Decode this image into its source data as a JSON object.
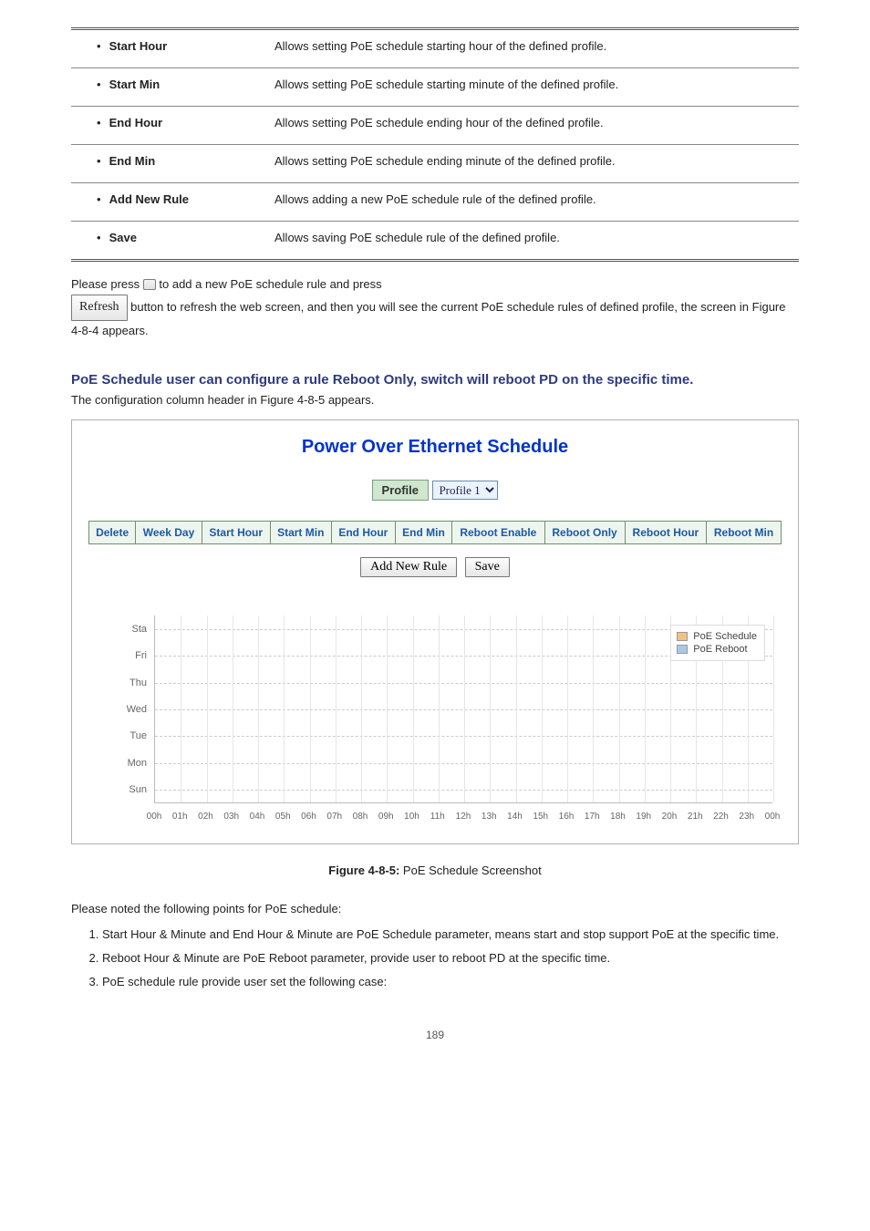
{
  "objects": [
    {
      "name": "Start Hour",
      "desc": "Allows setting PoE schedule starting hour of the defined profile."
    },
    {
      "name": "Start Min",
      "desc": "Allows setting PoE schedule starting minute of the defined profile."
    },
    {
      "name": "End Hour",
      "desc": "Allows setting PoE schedule ending hour of the defined profile."
    },
    {
      "name": "End Min",
      "desc": "Allows setting PoE schedule ending minute of the defined profile."
    },
    {
      "name": "Add New Rule",
      "desc": "Allows adding a new PoE schedule rule of the defined profile."
    },
    {
      "name": "Save",
      "desc": "Allows saving PoE schedule rule of the defined profile."
    }
  ],
  "para_before_refresh": "Please press ",
  "para_after_refresh_1": " to add a new PoE schedule rule and press ",
  "para_after_refresh_2": " button to refresh the web screen, and then you will see the current PoE schedule rules of defined profile, the screen in Figure 4-8-4 appears.",
  "refresh_label": "Refresh",
  "section_label": "PoE Schedule user can configure a rule ",
  "section_bold": "Reboot Only",
  "section_tail": ", switch will reboot PD on the specific time.",
  "configure_line": "The configuration column header in Figure 4-8-5 appears.",
  "panel_title": "Power Over Ethernet Schedule",
  "profile_label": "Profile",
  "profile_value": "Profile 1",
  "columns": [
    "Delete",
    "Week Day",
    "Start Hour",
    "Start Min",
    "End Hour",
    "End Min",
    "Reboot Enable",
    "Reboot Only",
    "Reboot Hour",
    "Reboot Min"
  ],
  "add_btn": "Add New Rule",
  "save_btn": "Save",
  "chart_data": {
    "type": "schedule-grid",
    "days": [
      "Sta",
      "Fri",
      "Thu",
      "Wed",
      "Tue",
      "Mon",
      "Sun"
    ],
    "hours": [
      "00h",
      "01h",
      "02h",
      "03h",
      "04h",
      "05h",
      "06h",
      "07h",
      "08h",
      "09h",
      "10h",
      "11h",
      "12h",
      "13h",
      "14h",
      "15h",
      "16h",
      "17h",
      "18h",
      "19h",
      "20h",
      "21h",
      "22h",
      "23h",
      "00h"
    ],
    "legend": [
      {
        "label": "PoE Schedule",
        "color": "#f2c080"
      },
      {
        "label": "PoE Reboot",
        "color": "#a9c8e8"
      }
    ],
    "series": []
  },
  "figure_caption_prefix": "Figure 4-8-5: ",
  "figure_caption": "PoE Schedule Screenshot",
  "note_title": "Please noted the following points for PoE schedule:",
  "notes": [
    "Start Hour & Minute and End Hour & Minute are PoE Schedule parameter, means start and stop support PoE at the specific time.",
    "Reboot Hour & Minute are PoE Reboot parameter, provide user to reboot PD at the specific time.",
    "PoE schedule rule provide user set the following case:"
  ],
  "page_number": "189"
}
